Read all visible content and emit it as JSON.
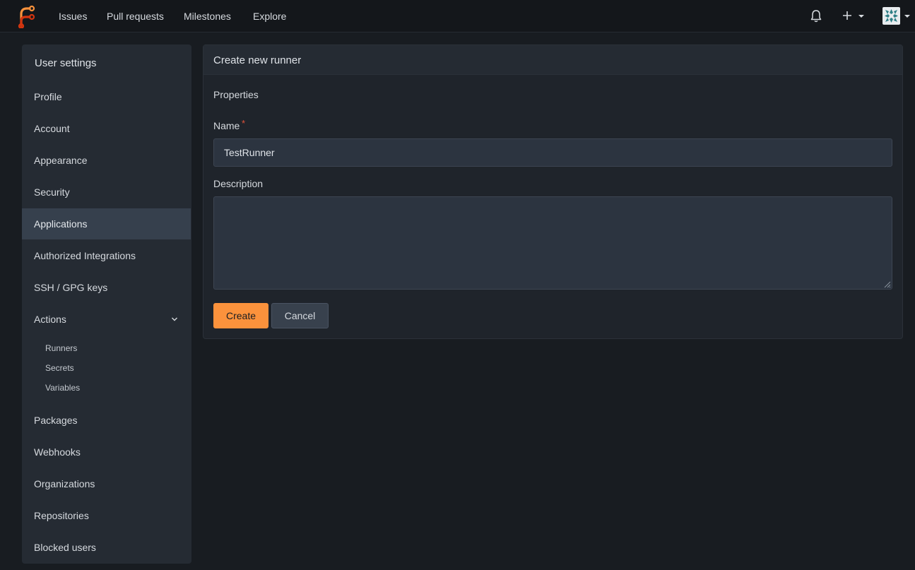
{
  "navbar": {
    "links": [
      "Issues",
      "Pull requests",
      "Milestones",
      "Explore"
    ],
    "icons": [
      "bell-icon",
      "plus-icon",
      "avatar"
    ]
  },
  "sidebar": {
    "title": "User settings",
    "items": [
      "Profile",
      "Account",
      "Appearance",
      "Security",
      "Applications",
      "Authorized Integrations",
      "SSH / GPG keys",
      "Actions",
      "Packages",
      "Webhooks",
      "Organizations",
      "Repositories",
      "Blocked users"
    ],
    "active": "Applications",
    "actions_sub": [
      "Runners",
      "Secrets",
      "Variables"
    ]
  },
  "form": {
    "title": "Create new runner",
    "section": "Properties",
    "name_label": "Name",
    "required_mark": "*",
    "name_value": "TestRunner",
    "description_label": "Description",
    "description_value": "",
    "create_label": "Create",
    "cancel_label": "Cancel"
  },
  "colors": {
    "accent": "#fb923c",
    "required": "#e0533a",
    "background": "#181c21"
  }
}
